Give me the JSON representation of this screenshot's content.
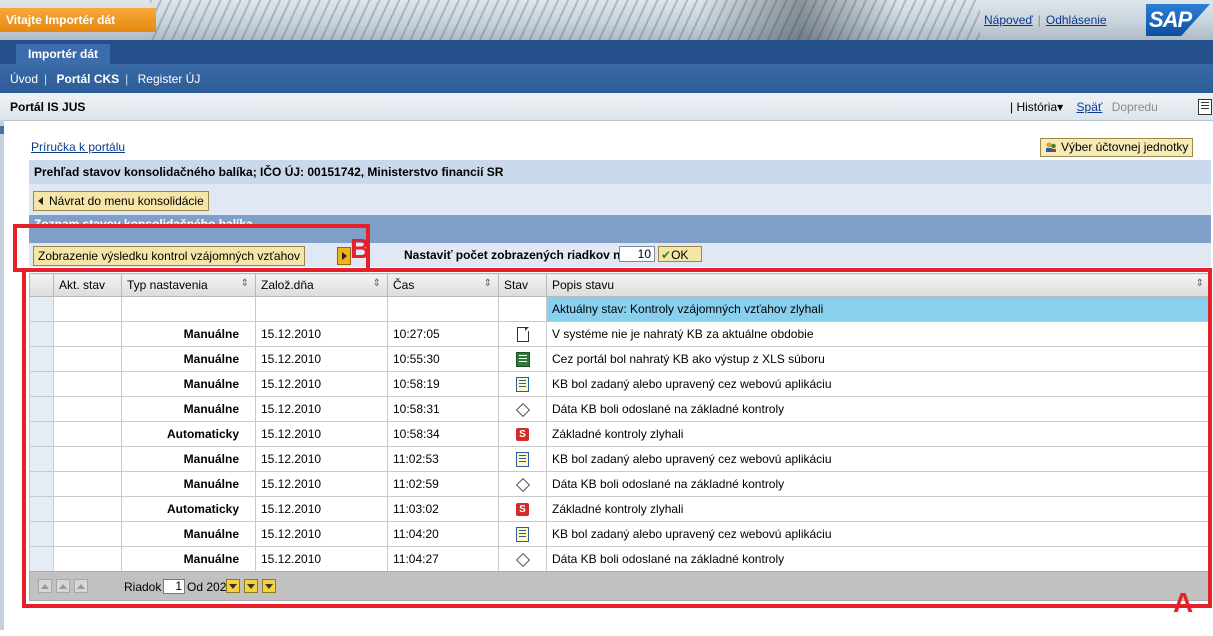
{
  "header": {
    "welcome": "Vitajte Importér dát",
    "help_link": "Nápoveď",
    "logout_link": "Odhlásenie",
    "logo": "SAP"
  },
  "nav": {
    "tab": "Importér dát",
    "items": [
      "Úvod",
      "Portál CKS",
      "Register ÚJ"
    ]
  },
  "titlebar": {
    "title": "Portál IS JUS",
    "history": "História",
    "back": "Späť",
    "forward": "Dopredu"
  },
  "content": {
    "guide_link": "Príručka k portálu",
    "select_unit_button": "Výber účtovnej jednotky",
    "overview_title": "Prehľad stavov konsolidačného balíka; IČO ÚJ: 00151742, Ministerstvo financií SR",
    "back_button": "Návrat do menu konsolidácie",
    "list_title": "Zoznam stavov konsolidačného balíka",
    "show_results_button": "Zobrazenie výsledku kontrol vzájomných vzťahov",
    "rows_label": "Nastaviť počet zobrazených riadkov na:",
    "rows_value": "10",
    "ok_button": "OK"
  },
  "table": {
    "columns": [
      "",
      "Akt. stav",
      "Typ nastavenia",
      "Založ.dňa",
      "Čas",
      "Stav",
      "Popis stavu"
    ],
    "current_row": "Aktuálny stav: Kontroly vzájomných vzťahov zlyhali",
    "rows": [
      {
        "type": "Manuálne",
        "date": "15.12.2010",
        "time": "10:27:05",
        "icon": "blank-document-icon",
        "desc": "V systéme nie je nahratý KB za aktuálne obdobie"
      },
      {
        "type": "Manuálne",
        "date": "15.12.2010",
        "time": "10:55:30",
        "icon": "excel-upload-icon",
        "desc": "Cez portál bol nahratý KB ako výstup z XLS súboru"
      },
      {
        "type": "Manuálne",
        "date": "15.12.2010",
        "time": "10:58:19",
        "icon": "web-edit-icon",
        "desc": "KB bol zadaný alebo upravený cez webovú aplikáciu"
      },
      {
        "type": "Manuálne",
        "date": "15.12.2010",
        "time": "10:58:31",
        "icon": "diamond-icon",
        "desc": "Dáta KB boli odoslané na základné kontroly"
      },
      {
        "type": "Automaticky",
        "date": "15.12.2010",
        "time": "10:58:34",
        "icon": "error-icon",
        "desc": "Základné kontroly zlyhali"
      },
      {
        "type": "Manuálne",
        "date": "15.12.2010",
        "time": "11:02:53",
        "icon": "web-edit-icon",
        "desc": "KB bol zadaný alebo upravený cez webovú aplikáciu"
      },
      {
        "type": "Manuálne",
        "date": "15.12.2010",
        "time": "11:02:59",
        "icon": "diamond-icon",
        "desc": "Dáta KB boli odoslané na základné kontroly"
      },
      {
        "type": "Automaticky",
        "date": "15.12.2010",
        "time": "11:03:02",
        "icon": "error-icon",
        "desc": "Základné kontroly zlyhali"
      },
      {
        "type": "Manuálne",
        "date": "15.12.2010",
        "time": "11:04:20",
        "icon": "web-edit-icon",
        "desc": "KB bol zadaný alebo upravený cez webovú aplikáciu"
      },
      {
        "type": "Manuálne",
        "date": "15.12.2010",
        "time": "11:04:27",
        "icon": "diamond-icon",
        "desc": "Dáta KB boli odoslané na základné kontroly"
      }
    ]
  },
  "pager": {
    "row_label": "Riadok",
    "row_value": "1",
    "of_label": "Od 202"
  },
  "annotations": {
    "a": "A",
    "b": "B",
    "color": "#e5202a"
  }
}
